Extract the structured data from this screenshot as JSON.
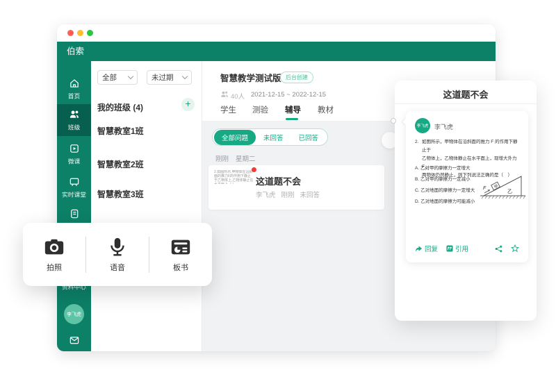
{
  "app": {
    "name": "伯索"
  },
  "colors": {
    "brand_teal": "#0d8068",
    "sidebar_active": "#07604f",
    "accent_green": "#17a884",
    "badge_red": "#f43b2e",
    "traffic_red": "#ff5f57",
    "traffic_yellow": "#febc2e",
    "traffic_green": "#28c840"
  },
  "sidebar": {
    "items": [
      {
        "label": "首页"
      },
      {
        "label": "班级"
      },
      {
        "label": "微课"
      },
      {
        "label": "实时课堂"
      },
      {
        "label": ""
      },
      {
        "label": "资料中心"
      }
    ],
    "avatar_name": "李飞虎"
  },
  "class_list": {
    "filter_type": "全部",
    "filter_status": "未过期",
    "section_title": "我的班级 (4)",
    "add_label": "+",
    "classes": [
      "智慧教室1班",
      "智慧教室2班",
      "智慧教室3班"
    ]
  },
  "class_detail": {
    "title": "智慧教学测试版",
    "badge": "后台创建",
    "student_count": "40人",
    "date_range": "2021-12-15 ~ 2022-12-15",
    "tabs": [
      "学生",
      "测验",
      "辅导",
      "教材"
    ],
    "active_tab": "辅导",
    "filters": [
      "全部问题",
      "未回答",
      "已回答"
    ],
    "active_filter": "全部问题",
    "time_recent": "刚刚",
    "time_day": "星期二",
    "card": {
      "thumb_text": "2.如图所示,甲物体在沿斜面的推力F的作用下静止于乙物体上,乙物体静止在水平面上（ ）",
      "title": "这道题不会",
      "meta_name": "李飞虎",
      "meta_time": "刚刚",
      "meta_status": "未回答"
    }
  },
  "popup": {
    "items": [
      {
        "label": "拍照"
      },
      {
        "label": "语音"
      },
      {
        "label": "板书"
      }
    ]
  },
  "question_panel": {
    "title": "这道题不会",
    "author": "李飞虎",
    "avatar_text": "李飞虎",
    "q_no": "2.",
    "lines": [
      "如图所示，甲物体在沿斜面的推力 F 的作用下静止于",
      "乙物体上，乙物体静止在水平面上，现增大外力 F，",
      "两物体仍然静止，则下列说法正确的是（　）"
    ],
    "options": [
      "A. 乙对甲的摩擦力一定增大",
      "B. 乙对甲的摩擦力一定减小",
      "C. 乙对地面的摩擦力一定增大",
      "D. 乙对地面的摩擦力可能减小"
    ],
    "diagram": {
      "force": "F",
      "block": "甲",
      "wedge": "乙"
    },
    "reply_label": "回复",
    "quote_label": "引用"
  }
}
